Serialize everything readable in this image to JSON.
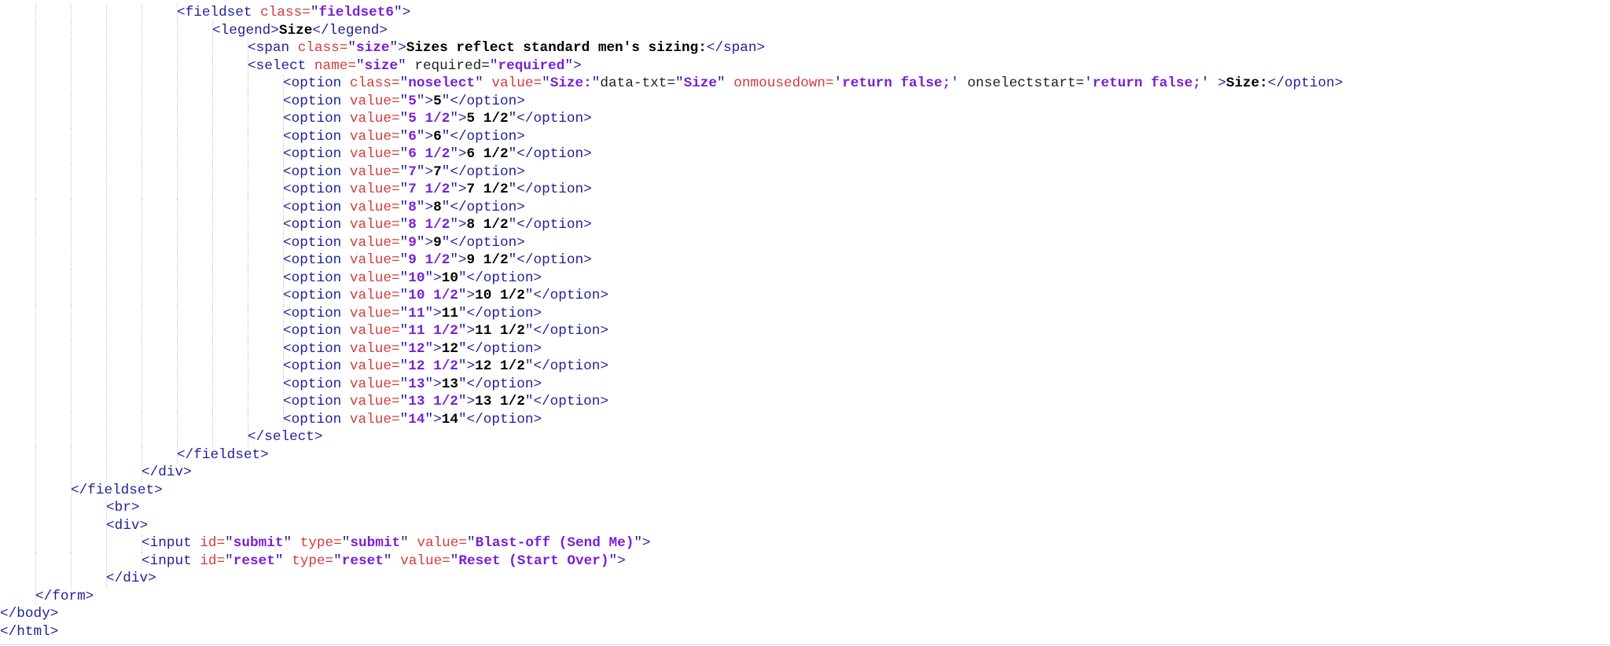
{
  "editor": {
    "lines": [
      {
        "indent": 5,
        "tokens": [
          {
            "t": "tag",
            "v": "<fieldset "
          },
          {
            "t": "attr",
            "v": "class="
          },
          {
            "t": "tag",
            "v": "\""
          },
          {
            "t": "val",
            "v": "fieldset6"
          },
          {
            "t": "tag",
            "v": "\">"
          }
        ]
      },
      {
        "indent": 6,
        "tokens": [
          {
            "t": "tag",
            "v": "<legend>"
          },
          {
            "t": "plain",
            "v": "Size"
          },
          {
            "t": "tag",
            "v": "</legend>"
          }
        ]
      },
      {
        "indent": 7,
        "tokens": [
          {
            "t": "tag",
            "v": "<span "
          },
          {
            "t": "attr",
            "v": "class="
          },
          {
            "t": "tag",
            "v": "\""
          },
          {
            "t": "val",
            "v": "size"
          },
          {
            "t": "tag",
            "v": "\">"
          },
          {
            "t": "plain",
            "v": "Sizes reflect standard men's sizing:"
          },
          {
            "t": "tag",
            "v": "</span>"
          }
        ]
      },
      {
        "indent": 7,
        "tokens": [
          {
            "t": "tag",
            "v": "<select "
          },
          {
            "t": "attr",
            "v": "name="
          },
          {
            "t": "tag",
            "v": "\""
          },
          {
            "t": "val",
            "v": "size"
          },
          {
            "t": "tag",
            "v": "\" "
          },
          {
            "t": "norm",
            "v": "required="
          },
          {
            "t": "tag",
            "v": "\""
          },
          {
            "t": "val",
            "v": "required"
          },
          {
            "t": "tag",
            "v": "\">"
          }
        ]
      },
      {
        "indent": 8,
        "tokens": [
          {
            "t": "tag",
            "v": "<option "
          },
          {
            "t": "attr",
            "v": "class="
          },
          {
            "t": "tag",
            "v": "\""
          },
          {
            "t": "val",
            "v": "noselect"
          },
          {
            "t": "tag",
            "v": "\" "
          },
          {
            "t": "attr",
            "v": "value="
          },
          {
            "t": "tag",
            "v": "\""
          },
          {
            "t": "val",
            "v": "Size:"
          },
          {
            "t": "tag",
            "v": "\""
          },
          {
            "t": "norm",
            "v": "data-txt="
          },
          {
            "t": "tag",
            "v": "\""
          },
          {
            "t": "val",
            "v": "Size"
          },
          {
            "t": "tag",
            "v": "\" "
          },
          {
            "t": "attr",
            "v": "onmousedown="
          },
          {
            "t": "tag",
            "v": "'"
          },
          {
            "t": "val",
            "v": "return false;"
          },
          {
            "t": "tag",
            "v": "' "
          },
          {
            "t": "norm",
            "v": "onselectstart="
          },
          {
            "t": "tag",
            "v": "'"
          },
          {
            "t": "val",
            "v": "return false;"
          },
          {
            "t": "tag",
            "v": "' >"
          },
          {
            "t": "plain",
            "v": "Size:"
          },
          {
            "t": "tag",
            "v": "</option>"
          }
        ]
      },
      {
        "indent": 8,
        "tokens": [
          {
            "t": "tag",
            "v": "<option "
          },
          {
            "t": "attr",
            "v": "value="
          },
          {
            "t": "tag",
            "v": "\""
          },
          {
            "t": "val",
            "v": "5"
          },
          {
            "t": "tag",
            "v": "\">"
          },
          {
            "t": "plain",
            "v": "5"
          },
          {
            "t": "tag",
            "v": "\"</option>"
          }
        ]
      },
      {
        "indent": 8,
        "tokens": [
          {
            "t": "tag",
            "v": "<option "
          },
          {
            "t": "attr",
            "v": "value="
          },
          {
            "t": "tag",
            "v": "\""
          },
          {
            "t": "val",
            "v": "5 1/2"
          },
          {
            "t": "tag",
            "v": "\">"
          },
          {
            "t": "plain",
            "v": "5 1/2"
          },
          {
            "t": "tag",
            "v": "\"</option>"
          }
        ]
      },
      {
        "indent": 8,
        "tokens": [
          {
            "t": "tag",
            "v": "<option "
          },
          {
            "t": "attr",
            "v": "value="
          },
          {
            "t": "tag",
            "v": "\""
          },
          {
            "t": "val",
            "v": "6"
          },
          {
            "t": "tag",
            "v": "\">"
          },
          {
            "t": "plain",
            "v": "6"
          },
          {
            "t": "tag",
            "v": "\"</option>"
          }
        ]
      },
      {
        "indent": 8,
        "tokens": [
          {
            "t": "tag",
            "v": "<option "
          },
          {
            "t": "attr",
            "v": "value="
          },
          {
            "t": "tag",
            "v": "\""
          },
          {
            "t": "val",
            "v": "6 1/2"
          },
          {
            "t": "tag",
            "v": "\">"
          },
          {
            "t": "plain",
            "v": "6 1/2"
          },
          {
            "t": "tag",
            "v": "\"</option>"
          }
        ]
      },
      {
        "indent": 8,
        "tokens": [
          {
            "t": "tag",
            "v": "<option "
          },
          {
            "t": "attr",
            "v": "value="
          },
          {
            "t": "tag",
            "v": "\""
          },
          {
            "t": "val",
            "v": "7"
          },
          {
            "t": "tag",
            "v": "\">"
          },
          {
            "t": "plain",
            "v": "7"
          },
          {
            "t": "tag",
            "v": "\"</option>"
          }
        ]
      },
      {
        "indent": 8,
        "tokens": [
          {
            "t": "tag",
            "v": "<option "
          },
          {
            "t": "attr",
            "v": "value="
          },
          {
            "t": "tag",
            "v": "\""
          },
          {
            "t": "val",
            "v": "7 1/2"
          },
          {
            "t": "tag",
            "v": "\">"
          },
          {
            "t": "plain",
            "v": "7 1/2"
          },
          {
            "t": "tag",
            "v": "\"</option>"
          }
        ]
      },
      {
        "indent": 8,
        "tokens": [
          {
            "t": "tag",
            "v": "<option "
          },
          {
            "t": "attr",
            "v": "value="
          },
          {
            "t": "tag",
            "v": "\""
          },
          {
            "t": "val",
            "v": "8"
          },
          {
            "t": "tag",
            "v": "\">"
          },
          {
            "t": "plain",
            "v": "8"
          },
          {
            "t": "tag",
            "v": "\"</option>"
          }
        ]
      },
      {
        "indent": 8,
        "tokens": [
          {
            "t": "tag",
            "v": "<option "
          },
          {
            "t": "attr",
            "v": "value="
          },
          {
            "t": "tag",
            "v": "\""
          },
          {
            "t": "val",
            "v": "8 1/2"
          },
          {
            "t": "tag",
            "v": "\">"
          },
          {
            "t": "plain",
            "v": "8 1/2"
          },
          {
            "t": "tag",
            "v": "\"</option>"
          }
        ]
      },
      {
        "indent": 8,
        "tokens": [
          {
            "t": "tag",
            "v": "<option "
          },
          {
            "t": "attr",
            "v": "value="
          },
          {
            "t": "tag",
            "v": "\""
          },
          {
            "t": "val",
            "v": "9"
          },
          {
            "t": "tag",
            "v": "\">"
          },
          {
            "t": "plain",
            "v": "9"
          },
          {
            "t": "tag",
            "v": "\"</option>"
          }
        ]
      },
      {
        "indent": 8,
        "tokens": [
          {
            "t": "tag",
            "v": "<option "
          },
          {
            "t": "attr",
            "v": "value="
          },
          {
            "t": "tag",
            "v": "\""
          },
          {
            "t": "val",
            "v": "9 1/2"
          },
          {
            "t": "tag",
            "v": "\">"
          },
          {
            "t": "plain",
            "v": "9 1/2"
          },
          {
            "t": "tag",
            "v": "\"</option>"
          }
        ]
      },
      {
        "indent": 8,
        "tokens": [
          {
            "t": "tag",
            "v": "<option "
          },
          {
            "t": "attr",
            "v": "value="
          },
          {
            "t": "tag",
            "v": "\""
          },
          {
            "t": "val",
            "v": "10"
          },
          {
            "t": "tag",
            "v": "\">"
          },
          {
            "t": "plain",
            "v": "10"
          },
          {
            "t": "tag",
            "v": "\"</option>"
          }
        ]
      },
      {
        "indent": 8,
        "tokens": [
          {
            "t": "tag",
            "v": "<option "
          },
          {
            "t": "attr",
            "v": "value="
          },
          {
            "t": "tag",
            "v": "\""
          },
          {
            "t": "val",
            "v": "10 1/2"
          },
          {
            "t": "tag",
            "v": "\">"
          },
          {
            "t": "plain",
            "v": "10 1/2"
          },
          {
            "t": "tag",
            "v": "\"</option>"
          }
        ]
      },
      {
        "indent": 8,
        "tokens": [
          {
            "t": "tag",
            "v": "<option "
          },
          {
            "t": "attr",
            "v": "value="
          },
          {
            "t": "tag",
            "v": "\""
          },
          {
            "t": "val",
            "v": "11"
          },
          {
            "t": "tag",
            "v": "\">"
          },
          {
            "t": "plain",
            "v": "11"
          },
          {
            "t": "tag",
            "v": "\"</option>"
          }
        ]
      },
      {
        "indent": 8,
        "tokens": [
          {
            "t": "tag",
            "v": "<option "
          },
          {
            "t": "attr",
            "v": "value="
          },
          {
            "t": "tag",
            "v": "\""
          },
          {
            "t": "val",
            "v": "11 1/2"
          },
          {
            "t": "tag",
            "v": "\">"
          },
          {
            "t": "plain",
            "v": "11 1/2"
          },
          {
            "t": "tag",
            "v": "\"</option>"
          }
        ]
      },
      {
        "indent": 8,
        "tokens": [
          {
            "t": "tag",
            "v": "<option "
          },
          {
            "t": "attr",
            "v": "value="
          },
          {
            "t": "tag",
            "v": "\""
          },
          {
            "t": "val",
            "v": "12"
          },
          {
            "t": "tag",
            "v": "\">"
          },
          {
            "t": "plain",
            "v": "12"
          },
          {
            "t": "tag",
            "v": "\"</option>"
          }
        ]
      },
      {
        "indent": 8,
        "tokens": [
          {
            "t": "tag",
            "v": "<option "
          },
          {
            "t": "attr",
            "v": "value="
          },
          {
            "t": "tag",
            "v": "\""
          },
          {
            "t": "val",
            "v": "12 1/2"
          },
          {
            "t": "tag",
            "v": "\">"
          },
          {
            "t": "plain",
            "v": "12 1/2"
          },
          {
            "t": "tag",
            "v": "\"</option>"
          }
        ]
      },
      {
        "indent": 8,
        "tokens": [
          {
            "t": "tag",
            "v": "<option "
          },
          {
            "t": "attr",
            "v": "value="
          },
          {
            "t": "tag",
            "v": "\""
          },
          {
            "t": "val",
            "v": "13"
          },
          {
            "t": "tag",
            "v": "\">"
          },
          {
            "t": "plain",
            "v": "13"
          },
          {
            "t": "tag",
            "v": "\"</option>"
          }
        ]
      },
      {
        "indent": 8,
        "tokens": [
          {
            "t": "tag",
            "v": "<option "
          },
          {
            "t": "attr",
            "v": "value="
          },
          {
            "t": "tag",
            "v": "\""
          },
          {
            "t": "val",
            "v": "13 1/2"
          },
          {
            "t": "tag",
            "v": "\">"
          },
          {
            "t": "plain",
            "v": "13 1/2"
          },
          {
            "t": "tag",
            "v": "\"</option>"
          }
        ]
      },
      {
        "indent": 8,
        "tokens": [
          {
            "t": "tag",
            "v": "<option "
          },
          {
            "t": "attr",
            "v": "value="
          },
          {
            "t": "tag",
            "v": "\""
          },
          {
            "t": "val",
            "v": "14"
          },
          {
            "t": "tag",
            "v": "\">"
          },
          {
            "t": "plain",
            "v": "14"
          },
          {
            "t": "tag",
            "v": "\"</option>"
          }
        ]
      },
      {
        "indent": 7,
        "tokens": [
          {
            "t": "tag",
            "v": "</select>"
          }
        ]
      },
      {
        "indent": 5,
        "tokens": [
          {
            "t": "tag",
            "v": "</fieldset>"
          }
        ]
      },
      {
        "indent": 4,
        "tokens": [
          {
            "t": "tag",
            "v": "</div>"
          }
        ]
      },
      {
        "indent": 2,
        "tokens": [
          {
            "t": "tag",
            "v": "</fieldset>"
          }
        ]
      },
      {
        "indent": 3,
        "tokens": [
          {
            "t": "tag",
            "v": "<br>"
          }
        ]
      },
      {
        "indent": 3,
        "tokens": [
          {
            "t": "tag",
            "v": "<div>"
          }
        ]
      },
      {
        "indent": 4,
        "tokens": [
          {
            "t": "tag",
            "v": "<input "
          },
          {
            "t": "attr",
            "v": "id="
          },
          {
            "t": "tag",
            "v": "\""
          },
          {
            "t": "val",
            "v": "submit"
          },
          {
            "t": "tag",
            "v": "\" "
          },
          {
            "t": "attr",
            "v": "type="
          },
          {
            "t": "tag",
            "v": "\""
          },
          {
            "t": "val",
            "v": "submit"
          },
          {
            "t": "tag",
            "v": "\" "
          },
          {
            "t": "attr",
            "v": "value="
          },
          {
            "t": "tag",
            "v": "\""
          },
          {
            "t": "val",
            "v": "Blast-off (Send Me)"
          },
          {
            "t": "tag",
            "v": "\">"
          }
        ]
      },
      {
        "indent": 4,
        "tokens": [
          {
            "t": "tag",
            "v": "<input "
          },
          {
            "t": "attr",
            "v": "id="
          },
          {
            "t": "tag",
            "v": "\""
          },
          {
            "t": "val",
            "v": "reset"
          },
          {
            "t": "tag",
            "v": "\" "
          },
          {
            "t": "attr",
            "v": "type="
          },
          {
            "t": "tag",
            "v": "\""
          },
          {
            "t": "val",
            "v": "reset"
          },
          {
            "t": "tag",
            "v": "\" "
          },
          {
            "t": "attr",
            "v": "value="
          },
          {
            "t": "tag",
            "v": "\""
          },
          {
            "t": "val",
            "v": "Reset (Start Over)"
          },
          {
            "t": "tag",
            "v": "\">"
          }
        ]
      },
      {
        "indent": 3,
        "tokens": [
          {
            "t": "tag",
            "v": "</div>"
          }
        ]
      },
      {
        "indent": 1,
        "tokens": [
          {
            "t": "tag",
            "v": "</form>"
          }
        ]
      },
      {
        "indent": 0,
        "tokens": [
          {
            "t": "tag",
            "v": "</body>"
          }
        ]
      },
      {
        "indent": 0,
        "tokens": [
          {
            "t": "tag",
            "v": "</html>"
          }
        ]
      }
    ]
  }
}
